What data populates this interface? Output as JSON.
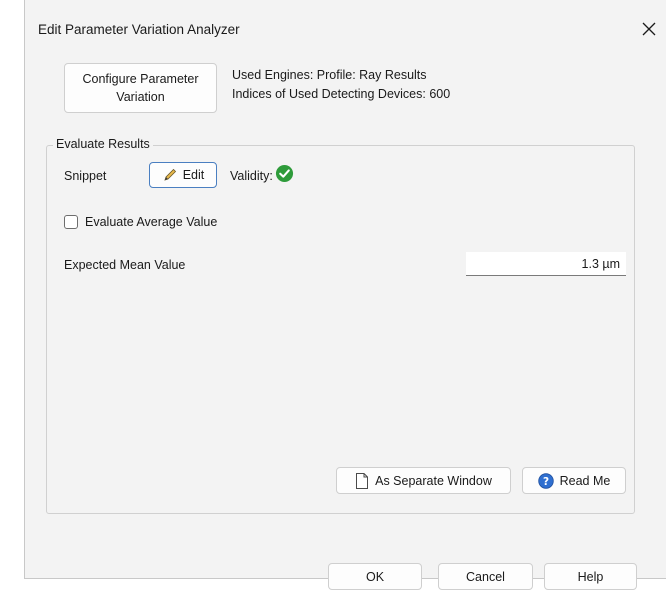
{
  "window": {
    "title": "Edit Parameter Variation Analyzer",
    "close_icon": "close-icon"
  },
  "configure": {
    "label": "Configure Parameter Variation"
  },
  "info": {
    "engines": "Used Engines: Profile: Ray Results",
    "devices": "Indices of Used Detecting Devices: 600"
  },
  "evaluate": {
    "group_title": "Evaluate Results",
    "snippet_label": "Snippet",
    "edit_label": "Edit",
    "edit_icon": "pencil-icon",
    "validity_label": "Validity:",
    "validity_icon": "check-circle-icon",
    "validity_color": "#2e9b3a",
    "average_label": "Evaluate Average Value",
    "average_checked": false,
    "mean_label": "Expected Mean Value",
    "mean_value": "1.3 µm"
  },
  "actions": {
    "separate_window": "As Separate Window",
    "separate_icon": "document-icon",
    "read_me": "Read Me",
    "read_me_icon": "help-circle-icon"
  },
  "dialog_buttons": {
    "ok": "OK",
    "cancel": "Cancel",
    "help": "Help"
  }
}
